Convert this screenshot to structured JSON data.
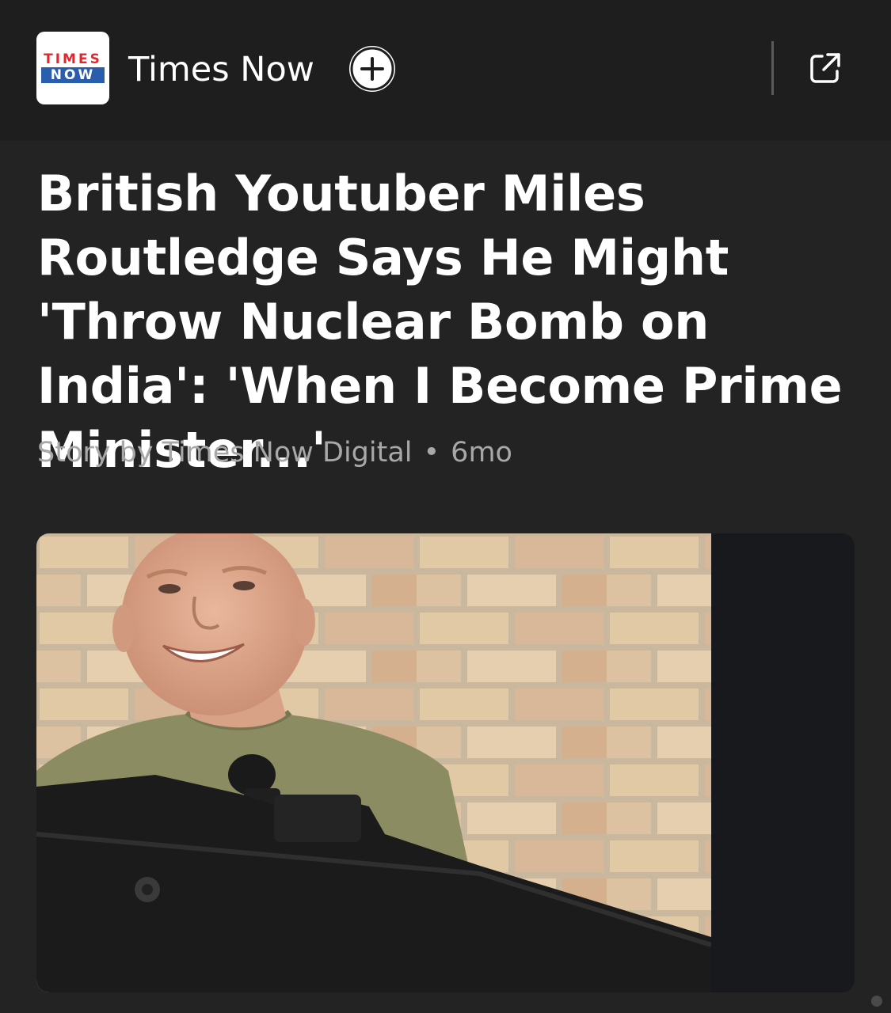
{
  "header": {
    "logo_line1": "TIMES",
    "logo_line2": "NOW",
    "source_name": "Times Now",
    "follow_icon": "plus-icon",
    "open_icon": "external-link-icon"
  },
  "article": {
    "headline": "British Youtuber Miles Routledge Says He Might 'Throw Nuclear Bomb on India': 'When I Become Prime Minister...'",
    "byline": "Story by Times Now Digital",
    "separator": "•",
    "age": "6mo"
  },
  "colors": {
    "background": "#232323",
    "header_background": "#1e1e1e",
    "text_primary": "#ffffff",
    "text_secondary": "#a8a8a8",
    "logo_red": "#e8232a",
    "logo_blue": "#2a5dab"
  }
}
